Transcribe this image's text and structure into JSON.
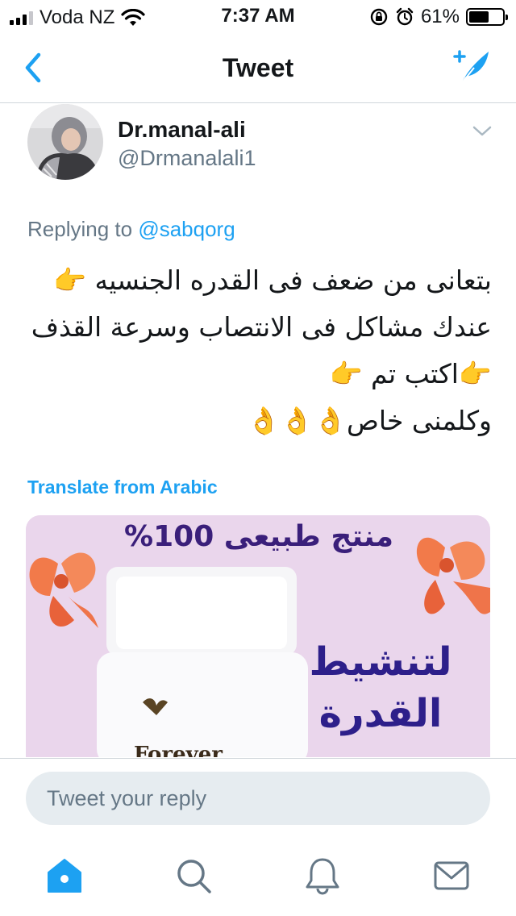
{
  "status_bar": {
    "carrier": "Voda NZ",
    "time": "7:37 AM",
    "battery_percent": "61%",
    "battery_level": 0.61,
    "icons": [
      "signal-icon",
      "wifi-icon",
      "rotation-lock-icon",
      "alarm-icon",
      "battery-icon"
    ]
  },
  "nav": {
    "title": "Tweet",
    "back_icon": "chevron-left-icon",
    "compose_icon": "compose-tweet-icon"
  },
  "tweet": {
    "author_name": "Dr.manal-ali",
    "author_handle": "@Drmanalali1",
    "replying_prefix": "Replying to",
    "replying_to": "@sabqorg",
    "body_lines": [
      "بتعانى من ضعف فى القدره الجنسيه 👉",
      "عندك مشاكل فى الانتصاب وسرعة القذف",
      "👉اكتب تم 👉",
      "وكلمنى خاص👌👌👌"
    ],
    "translate_label": "Translate from Arabic",
    "media": {
      "heading": "منتج طبيعى 100%",
      "headline": "لتنشيط القدرة",
      "brand": "Forever"
    }
  },
  "reply": {
    "placeholder": "Tweet your reply"
  },
  "tabs": [
    {
      "name": "home",
      "icon": "home-icon",
      "active": true
    },
    {
      "name": "search",
      "icon": "search-icon",
      "active": false
    },
    {
      "name": "notifications",
      "icon": "bell-icon",
      "active": false
    },
    {
      "name": "messages",
      "icon": "envelope-icon",
      "active": false
    }
  ],
  "colors": {
    "accent": "#1da1f2",
    "secondary_text": "#657786",
    "divider": "#d0d6db",
    "input_bg": "#e6ecf0",
    "media_bg": "#ead6ec",
    "media_text": "#2d1f8a"
  }
}
